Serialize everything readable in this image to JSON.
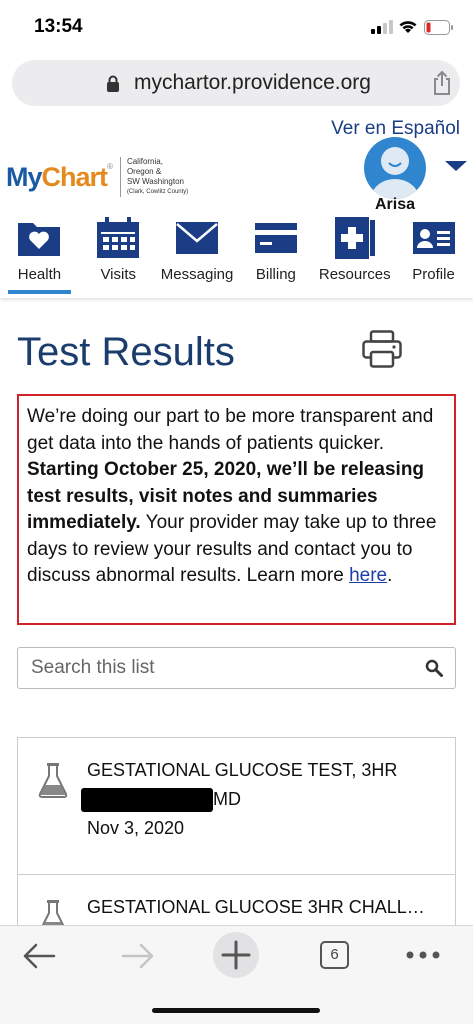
{
  "status_bar": {
    "time": "13:54"
  },
  "browser": {
    "url": "mychartor.providence.org",
    "tab_count": "6"
  },
  "header": {
    "language_link": "Ver en Español",
    "logo": {
      "my": "My",
      "chart": "Chart",
      "region_lines": [
        "California,",
        "Oregon &",
        "SW Washington"
      ],
      "region_small": "(Clark, Cowlitz County)"
    },
    "user_name": "Arisa"
  },
  "nav": {
    "tabs": [
      {
        "label": "Health",
        "icon": "folder-heart-icon",
        "active": true
      },
      {
        "label": "Visits",
        "icon": "calendar-icon",
        "active": false
      },
      {
        "label": "Messaging",
        "icon": "envelope-icon",
        "active": false
      },
      {
        "label": "Billing",
        "icon": "credit-card-icon",
        "active": false
      },
      {
        "label": "Resources",
        "icon": "first-aid-book-icon",
        "active": false
      },
      {
        "label": "Profile",
        "icon": "id-card-icon",
        "active": false
      }
    ]
  },
  "page": {
    "title": "Test Results",
    "notice": {
      "text1": "We’re doing our part to be more transparent and get data into the hands of patients quicker. ",
      "bold": "Starting October 25, 2020, we’ll be releasing test results, visit notes and summaries immediately.",
      "text2": " Your provider may take up to three days to review your results and contact you to discuss abnormal results. Learn more ",
      "link": "here",
      "end": "."
    },
    "search": {
      "placeholder": "Search this list"
    },
    "results": [
      {
        "name": "GESTATIONAL GLUCOSE TEST, 3HR",
        "provider_suffix": "MD",
        "date": "Nov 3, 2020"
      },
      {
        "name": "GESTATIONAL GLUCOSE 3HR CHALL…"
      }
    ]
  },
  "colors": {
    "brand_blue": "#1a3d86",
    "accent_blue": "#2f86cf",
    "notice_border": "#d0222a",
    "chart_orange": "#e58a1f"
  }
}
